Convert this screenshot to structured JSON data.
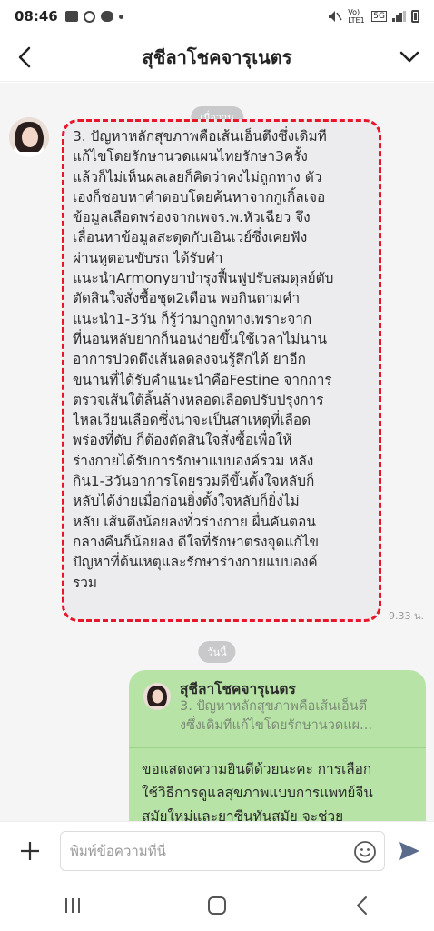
{
  "status_bar": {
    "time": "08:46",
    "network_label": "Vo) LTE1",
    "network_type": "5G"
  },
  "header": {
    "title": "สุชีลาโชคจารุเนตร"
  },
  "chat": {
    "date_yesterday": "เมื่อวาน",
    "date_today": "วันนี้",
    "incoming": {
      "time": "9.33 น.",
      "lines": [
        "3. ปัญหาหลักสุขภาพคือเส้นเอ็นตึงซึ่งเดิมที",
        "แก้ไขโดยรักษานวดแผนไทยรักษา3ครั้ง",
        "แล้วก็ไม่เห็นผลเลยก็คิดว่าคงไม่ถูกทาง ตัว",
        "เองก็ชอบหาคำตอบโดยค้นหาจากกูเกิ้ลเจอ",
        "ข้อมูลเลือดพร่องจากเพจร.พ.หัวเฉียว จึง",
        "เลื่อนหาข้อมูลสะดุดกับเอินเวย์ซึ่งเคยฟัง",
        "ผ่านหูตอนขับรถ ได้รับคำ",
        "แนะนำArmonyยาบำรุงฟื้นฟูปรับสมดุลย์ตับ",
        "ตัดสินใจสั่งซื้อชุด2เดือน พอกินตามคำ",
        "แนะนำ1-3วัน ก็รู้ว่ามาถูกทางเพราะจาก",
        "ที่นอนหลับยากก็นอนง่ายขึ้นใช้เวลาไม่นาน",
        "อาการปวดตึงเส้นลดลงจนรู้สึกได้ ยาอีก",
        "ขนานที่ได้รับคำแนะนำคือFestine จากการ",
        "ตรวจเส้นใต้ลิ้นล้างหลอดเลือดปรับปรุงการ",
        "ไหลเวียนเลือดซึ่งน่าจะเป็นสาเหตุที่เลือด",
        "พร่องที่ตับ ก็ต้องตัดสินใจสั่งซื้อเพื่อให้",
        "ร่างกายได้รับการรักษาแบบองค์รวม หลัง",
        "กิน1-3วันอาการโดยรวมดีขึ้นตั้งใจหลับก็",
        "หลับได้ง่ายเมื่อก่อนยิ่งตั้งใจหลับก็ยิ่งไม่",
        "หลับ เส้นตึงน้อยลงทั่วร่างกาย ผื่นคันตอน",
        "กลางคืนก็น้อยลง ดีใจที่รักษาตรงจุดแก้ไข",
        "ปัญหาที่ต้นเหตุและรักษาร่างกายแบบองค์",
        "รวม"
      ]
    },
    "outgoing": {
      "reply_name": "สุชีลาโชคจารุเนตร",
      "reply_lines": [
        "3. ปัญหาหลักสุขภาพคือเส้นเอ็นตึ",
        "งซึ่งเดิมทีแก้ไขโดยรักษานวดแผ..."
      ],
      "lines": [
        "ขอแสดงความยินดีด้วยนะคะ การเลือก",
        "ใช้วิธีการดูแลสุขภาพแบบการแพทย์จีน",
        "สมัยใหม่และยาซีนทันสมัย จะช่วย"
      ]
    }
  },
  "input": {
    "placeholder": "พิมพ์ข้อความที่นี่"
  },
  "colors": {
    "incoming_bubble": "#ececef",
    "outgoing_bubble": "#b7e4a6",
    "highlight_frame": "#e8162a",
    "send_icon": "#5a6b8c"
  },
  "icons": {
    "back": "chevron-left-icon",
    "menu": "chevron-down-icon",
    "plus": "plus-icon",
    "emoji": "smiley-icon",
    "send": "send-icon",
    "nav_recent": "recent-apps-icon",
    "nav_home": "home-icon",
    "nav_back": "back-icon"
  }
}
